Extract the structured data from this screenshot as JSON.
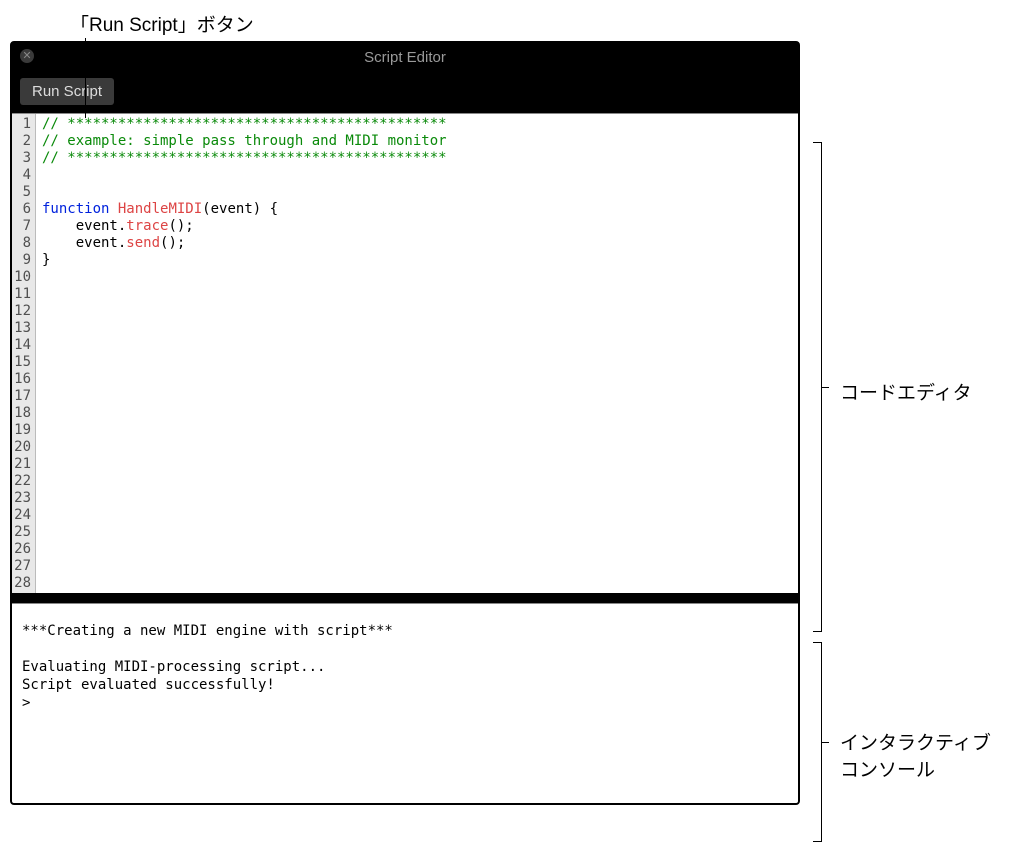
{
  "annotations": {
    "run_button": "「Run Script」ボタン",
    "code_editor": "コードエディタ",
    "interactive_console_line1": "インタラクティブ",
    "interactive_console_line2": "コンソール"
  },
  "window": {
    "title": "Script Editor",
    "close_glyph": "✕"
  },
  "toolbar": {
    "run_label": "Run Script"
  },
  "editor": {
    "line_count": 28,
    "lines": [
      {
        "tokens": [
          {
            "cls": "tok-comment",
            "text": "// *********************************************"
          }
        ]
      },
      {
        "tokens": [
          {
            "cls": "tok-comment",
            "text": "// example: simple pass through and MIDI monitor"
          }
        ]
      },
      {
        "tokens": [
          {
            "cls": "tok-comment",
            "text": "// *********************************************"
          }
        ]
      },
      {
        "tokens": []
      },
      {
        "tokens": []
      },
      {
        "tokens": [
          {
            "cls": "tok-keyword",
            "text": "function"
          },
          {
            "cls": "tok-plain",
            "text": " "
          },
          {
            "cls": "tok-funcname",
            "text": "HandleMIDI"
          },
          {
            "cls": "tok-plain",
            "text": "(event) {"
          }
        ]
      },
      {
        "tokens": [
          {
            "cls": "tok-plain",
            "text": "    event."
          },
          {
            "cls": "tok-method",
            "text": "trace"
          },
          {
            "cls": "tok-plain",
            "text": "();"
          }
        ]
      },
      {
        "tokens": [
          {
            "cls": "tok-plain",
            "text": "    event."
          },
          {
            "cls": "tok-method",
            "text": "send"
          },
          {
            "cls": "tok-plain",
            "text": "();"
          }
        ]
      },
      {
        "tokens": [
          {
            "cls": "tok-plain",
            "text": "}"
          }
        ]
      }
    ]
  },
  "console": {
    "lines": [
      "***Creating a new MIDI engine with script***",
      "",
      "Evaluating MIDI-processing script...",
      "Script evaluated successfully!",
      ">"
    ]
  }
}
